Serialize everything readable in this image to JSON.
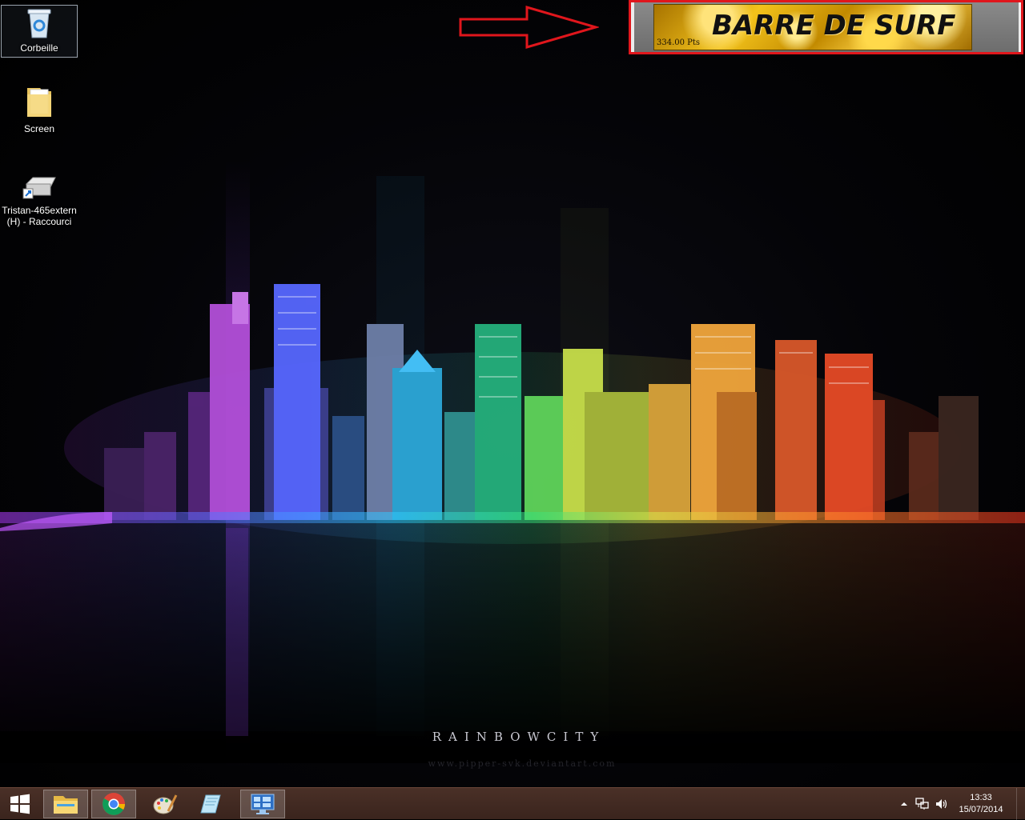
{
  "desktop": {
    "icons": [
      {
        "label": "Corbeille",
        "icon": "recycle-bin-icon"
      },
      {
        "label": "Screen",
        "icon": "folder-icon"
      },
      {
        "label_line1": "Tristan-465extern",
        "label_line2": "(H) - Raccourci",
        "icon": "external-drive-shortcut-icon"
      }
    ]
  },
  "wallpaper": {
    "title": "RAINBOWCITY",
    "credit": "www.pipper-svk.deviantart.com"
  },
  "surf_bar": {
    "title": "BARRE DE SURF",
    "points": "334.00 Pts",
    "annotation_color": "#e0161c"
  },
  "taskbar": {
    "start": "windows-logo-icon",
    "apps": [
      {
        "name": "file-explorer-icon",
        "open": true
      },
      {
        "name": "chrome-icon",
        "open": true
      },
      {
        "name": "paint-icon",
        "open": false
      },
      {
        "name": "notepad-icon",
        "open": false
      },
      {
        "name": "remote-desktop-icon",
        "open": true
      }
    ],
    "tray": {
      "chevron": "show-hidden-icons-icon",
      "network": "network-icon",
      "volume": "volume-icon"
    },
    "clock": {
      "time": "13:33",
      "date": "15/07/2014"
    }
  },
  "colors": {
    "taskbar": "#3e2820",
    "surf_gold": "#f2c21b"
  }
}
